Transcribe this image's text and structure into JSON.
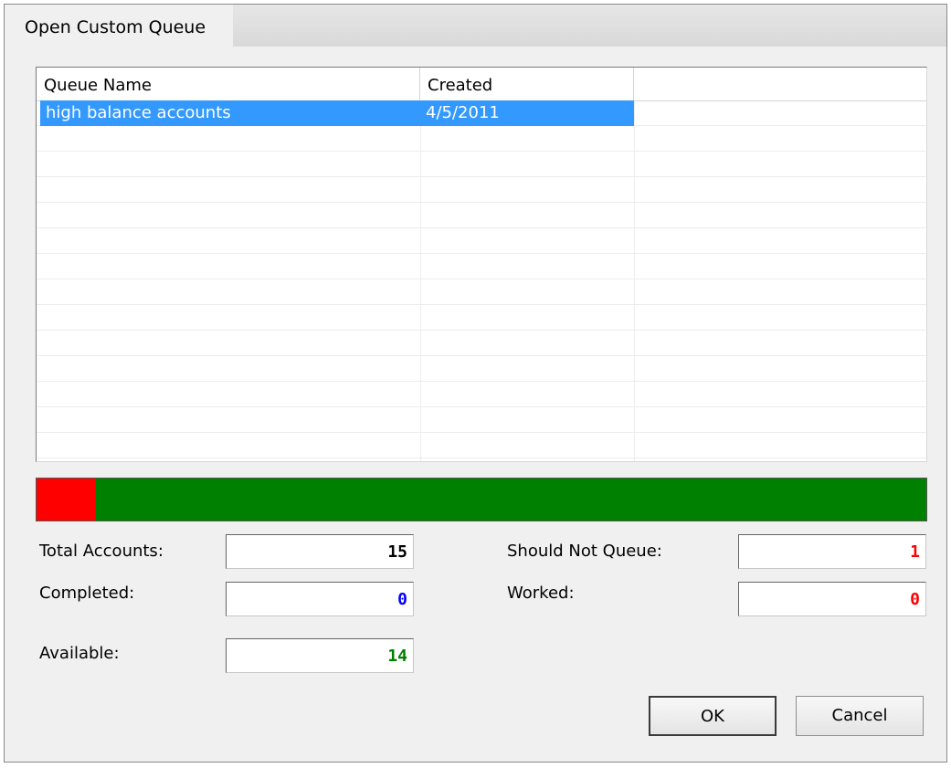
{
  "window": {
    "title": "Open Custom Queue"
  },
  "list": {
    "columns": [
      "Queue Name",
      "Created",
      ""
    ],
    "rows": [
      {
        "name": "high balance accounts",
        "created": "4/5/2011",
        "selected": true
      }
    ]
  },
  "progress": {
    "red_fraction": 0.067,
    "red_color": "#ff0000",
    "green_color": "#008000"
  },
  "stats": {
    "total_label": "Total Accounts:",
    "total_value": "15",
    "total_color": "#000000",
    "completed_label": "Completed:",
    "completed_value": "0",
    "completed_color": "#0000ff",
    "available_label": "Available:",
    "available_value": "14",
    "available_color": "#008000",
    "should_not_queue_label": "Should Not Queue:",
    "should_not_queue_value": "1",
    "should_not_queue_color": "#ff0000",
    "worked_label": "Worked:",
    "worked_value": "0",
    "worked_color": "#ff0000"
  },
  "buttons": {
    "ok": "OK",
    "cancel": "Cancel"
  }
}
